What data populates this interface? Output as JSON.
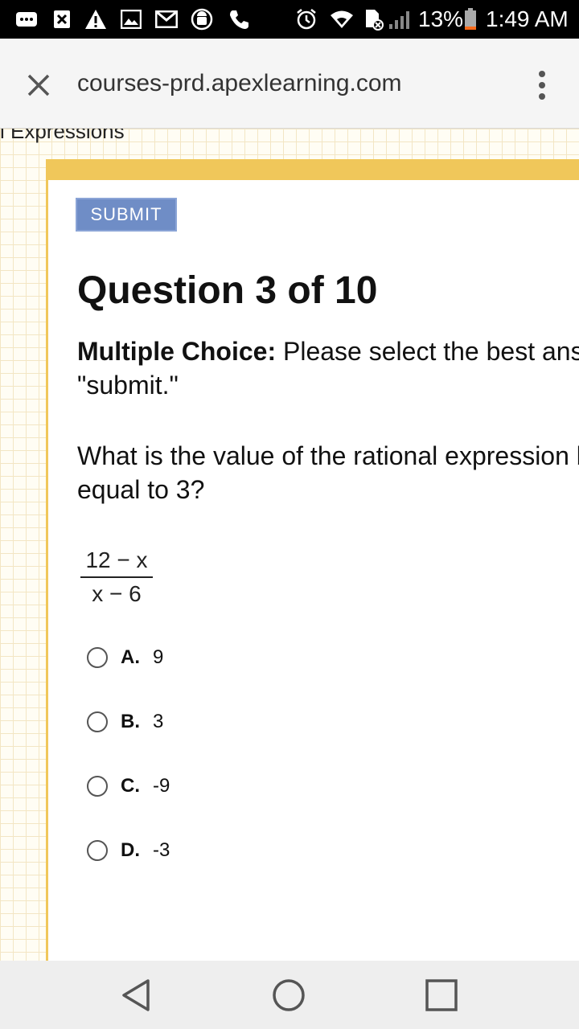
{
  "status_bar": {
    "icons": [
      "more-icon",
      "close-box-icon",
      "warning-icon",
      "image-icon",
      "gmail-icon",
      "android-icon",
      "phone-icon",
      "alarm-icon",
      "wifi-icon",
      "no-sim-icon",
      "signal-icon",
      "battery-icon"
    ],
    "battery": "13%",
    "time": "1:49 AM"
  },
  "browser": {
    "url": "courses-prd.apexlearning.com"
  },
  "page": {
    "breadcrumb": "l Expressions",
    "submit_label": "SUBMIT",
    "question_title": "Question 3 of 10",
    "instruction_bold": "Multiple Choice:",
    "instruction_rest": " Please select the best answer and click",
    "instruction_line2": "\"submit.\"",
    "question_line1": "What is the value of the rational expression below when x is",
    "question_line2": "equal to 3?",
    "fraction_numerator": "12 − x",
    "fraction_denominator": "x − 6",
    "options": [
      {
        "letter": "A.",
        "value": "9"
      },
      {
        "letter": "B.",
        "value": "3"
      },
      {
        "letter": "C.",
        "value": "-9"
      },
      {
        "letter": "D.",
        "value": "-3"
      }
    ]
  },
  "colors": {
    "card_accent": "#f0c75a",
    "submit_bg": "#6f8dc6"
  }
}
